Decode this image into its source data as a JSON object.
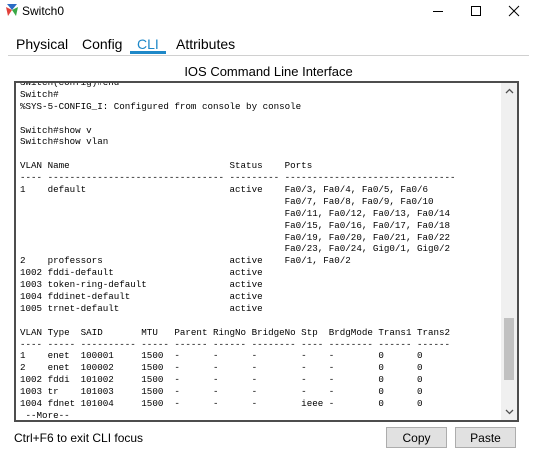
{
  "window": {
    "title": "Switch0",
    "app_icon": "packet-tracer-icon"
  },
  "tabs": [
    {
      "label": "Physical",
      "active": false
    },
    {
      "label": "Config",
      "active": false
    },
    {
      "label": "CLI",
      "active": true
    },
    {
      "label": "Attributes",
      "active": false
    }
  ],
  "panel": {
    "title": "IOS Command Line Interface"
  },
  "terminal": {
    "lines": [
      "Switch(config)#end",
      "Switch#",
      "%SYS-5-CONFIG_I: Configured from console by console",
      "",
      "Switch#show v",
      "Switch#show vlan",
      "",
      "VLAN Name                             Status    Ports",
      "---- -------------------------------- --------- -------------------------------",
      "1    default                          active    Fa0/3, Fa0/4, Fa0/5, Fa0/6",
      "                                                Fa0/7, Fa0/8, Fa0/9, Fa0/10",
      "                                                Fa0/11, Fa0/12, Fa0/13, Fa0/14",
      "                                                Fa0/15, Fa0/16, Fa0/17, Fa0/18",
      "                                                Fa0/19, Fa0/20, Fa0/21, Fa0/22",
      "                                                Fa0/23, Fa0/24, Gig0/1, Gig0/2",
      "2    professors                       active    Fa0/1, Fa0/2",
      "1002 fddi-default                     active",
      "1003 token-ring-default               active",
      "1004 fddinet-default                  active",
      "1005 trnet-default                    active",
      "",
      "VLAN Type  SAID       MTU   Parent RingNo BridgeNo Stp  BrdgMode Trans1 Trans2",
      "---- ----- ---------- ----- ------ ------ -------- ---- -------- ------ ------",
      "1    enet  100001     1500  -      -      -        -    -        0      0",
      "2    enet  100002     1500  -      -      -        -    -        0      0",
      "1002 fddi  101002     1500  -      -      -        -    -        0      0",
      "1003 tr    101003     1500  -      -      -        -    -        0      0",
      "1004 fdnet 101004     1500  -      -      -        ieee -        0      0",
      " --More--"
    ],
    "scroll_position": 0.9
  },
  "footer": {
    "hint": "Ctrl+F6 to exit CLI focus",
    "copy_label": "Copy",
    "paste_label": "Paste"
  },
  "colors": {
    "accent": "#1e88c8",
    "terminal_border": "#4d4d4d",
    "button_bg": "#e1e1e1"
  }
}
